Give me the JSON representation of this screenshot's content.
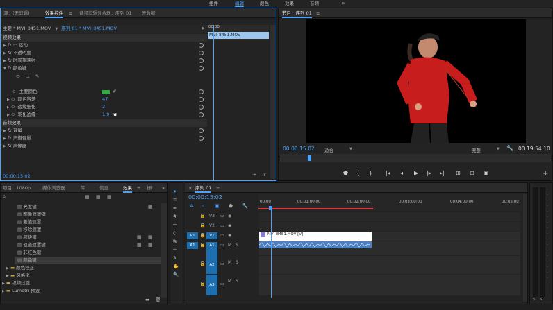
{
  "workspaces": [
    "组件",
    "编辑",
    "颜色",
    "效果",
    "音频"
  ],
  "active_workspace": "编辑",
  "effect_controls": {
    "tabs": [
      "源：(无剪辑)",
      "效果控件",
      "音频剪辑混合器：序列 01",
      "元数据"
    ],
    "source": "主要 * MVI_8451.MOV",
    "sequence": "序列 01 * MVI_8451.MOV",
    "clip_label": "MVI_8451.MOV",
    "ruler_time": "00:00",
    "video_effects_header": "视频效果",
    "audio_effects_header": "音频效果",
    "effects": [
      "运动",
      "不透明度",
      "时间重映射",
      "颜色键"
    ],
    "key_color_label": "主要颜色",
    "key_color": "#33aa44",
    "params": [
      {
        "label": "颜色容差",
        "value": "47"
      },
      {
        "label": "边缘细化",
        "value": "2"
      },
      {
        "label": "羽化边缘",
        "value": "1.9"
      }
    ],
    "audio_effects": [
      "音量",
      "声道音量",
      "声像器"
    ],
    "timecode": "00:00:15:02"
  },
  "program": {
    "title": "节目：序列 01",
    "timecode": "00:00:15:02",
    "fit": "适合",
    "quality": "完整",
    "duration": "00:19:54:10"
  },
  "project": {
    "tabs": [
      "项目：1080p",
      "媒体浏览器",
      "库",
      "信息",
      "效果",
      "标i"
    ],
    "search_placeholder": "ρ",
    "items": [
      {
        "label": "亮度键",
        "badge": true
      },
      {
        "label": "图像遮罩键",
        "badge": false
      },
      {
        "label": "差值遮罩",
        "badge": false
      },
      {
        "label": "移除遮罩",
        "badge": false
      },
      {
        "label": "超级键",
        "badge": true
      },
      {
        "label": "轨道遮罩键",
        "badge": true
      },
      {
        "label": "非红色键",
        "badge": false
      },
      {
        "label": "颜色键",
        "badge": false
      }
    ],
    "folders": [
      "颜色校正",
      "风格化",
      "视频过渡",
      "Lumetri 预设"
    ]
  },
  "timeline": {
    "tab": "序列 01",
    "timecode": "00:00:15:02",
    "ruler": [
      "00:00",
      "00:01:00:00",
      "00:02:00:00",
      "00:03:00:00",
      "00:04:00:00",
      "00:05:00"
    ],
    "tracks": [
      {
        "name": "V3",
        "src": ""
      },
      {
        "name": "V2",
        "src": ""
      },
      {
        "name": "V1",
        "src": "V1"
      },
      {
        "name": "A1",
        "src": "A1"
      },
      {
        "name": "A2",
        "src": ""
      },
      {
        "name": "A3",
        "src": ""
      }
    ],
    "clip_label": "MVI_8451.MOV [V]"
  },
  "colors": {
    "accent": "#4aa3ff",
    "clip_video": "#ffffff",
    "clip_audio": "#4b7fc0",
    "key_green": "#33aa44"
  }
}
